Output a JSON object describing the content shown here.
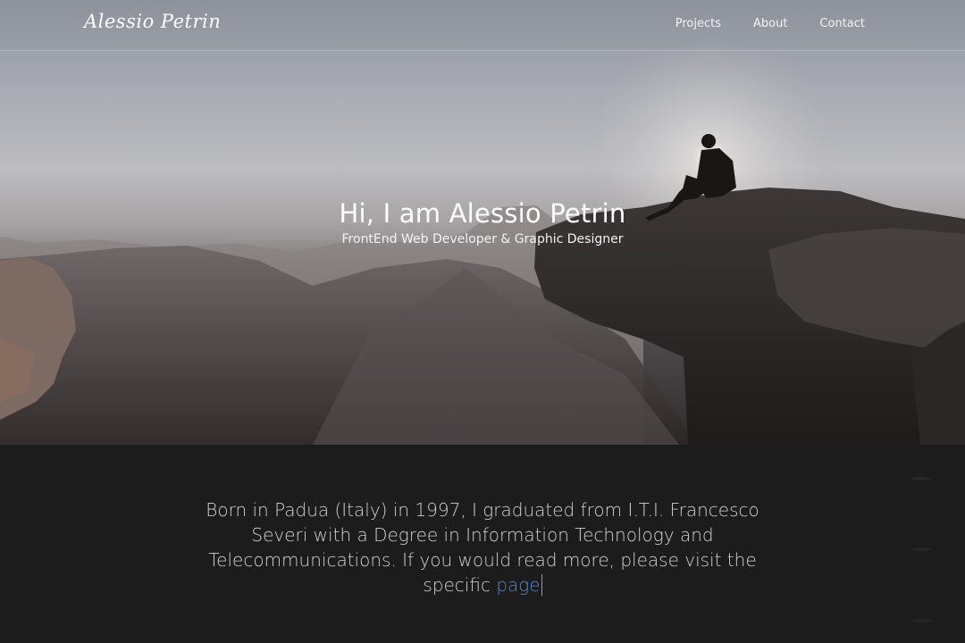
{
  "navbar": {
    "brand": "Alessio Petrin",
    "links": [
      "Projects",
      "About",
      "Contact"
    ]
  },
  "hero": {
    "title": "Hi, I am Alessio Petrin",
    "subtitle": "FrontEnd Web Developer & Graphic Designer"
  },
  "about": {
    "text": "Born in Padua (Italy) in 1997, I graduated from I.T.I. Francesco Severi with a Degree in Information Technology and Telecommunications. If you would read more, please visit the specific ",
    "link_label": "page"
  },
  "colors": {
    "link": "#5b86c4",
    "about_background": "#1c1c1c"
  }
}
